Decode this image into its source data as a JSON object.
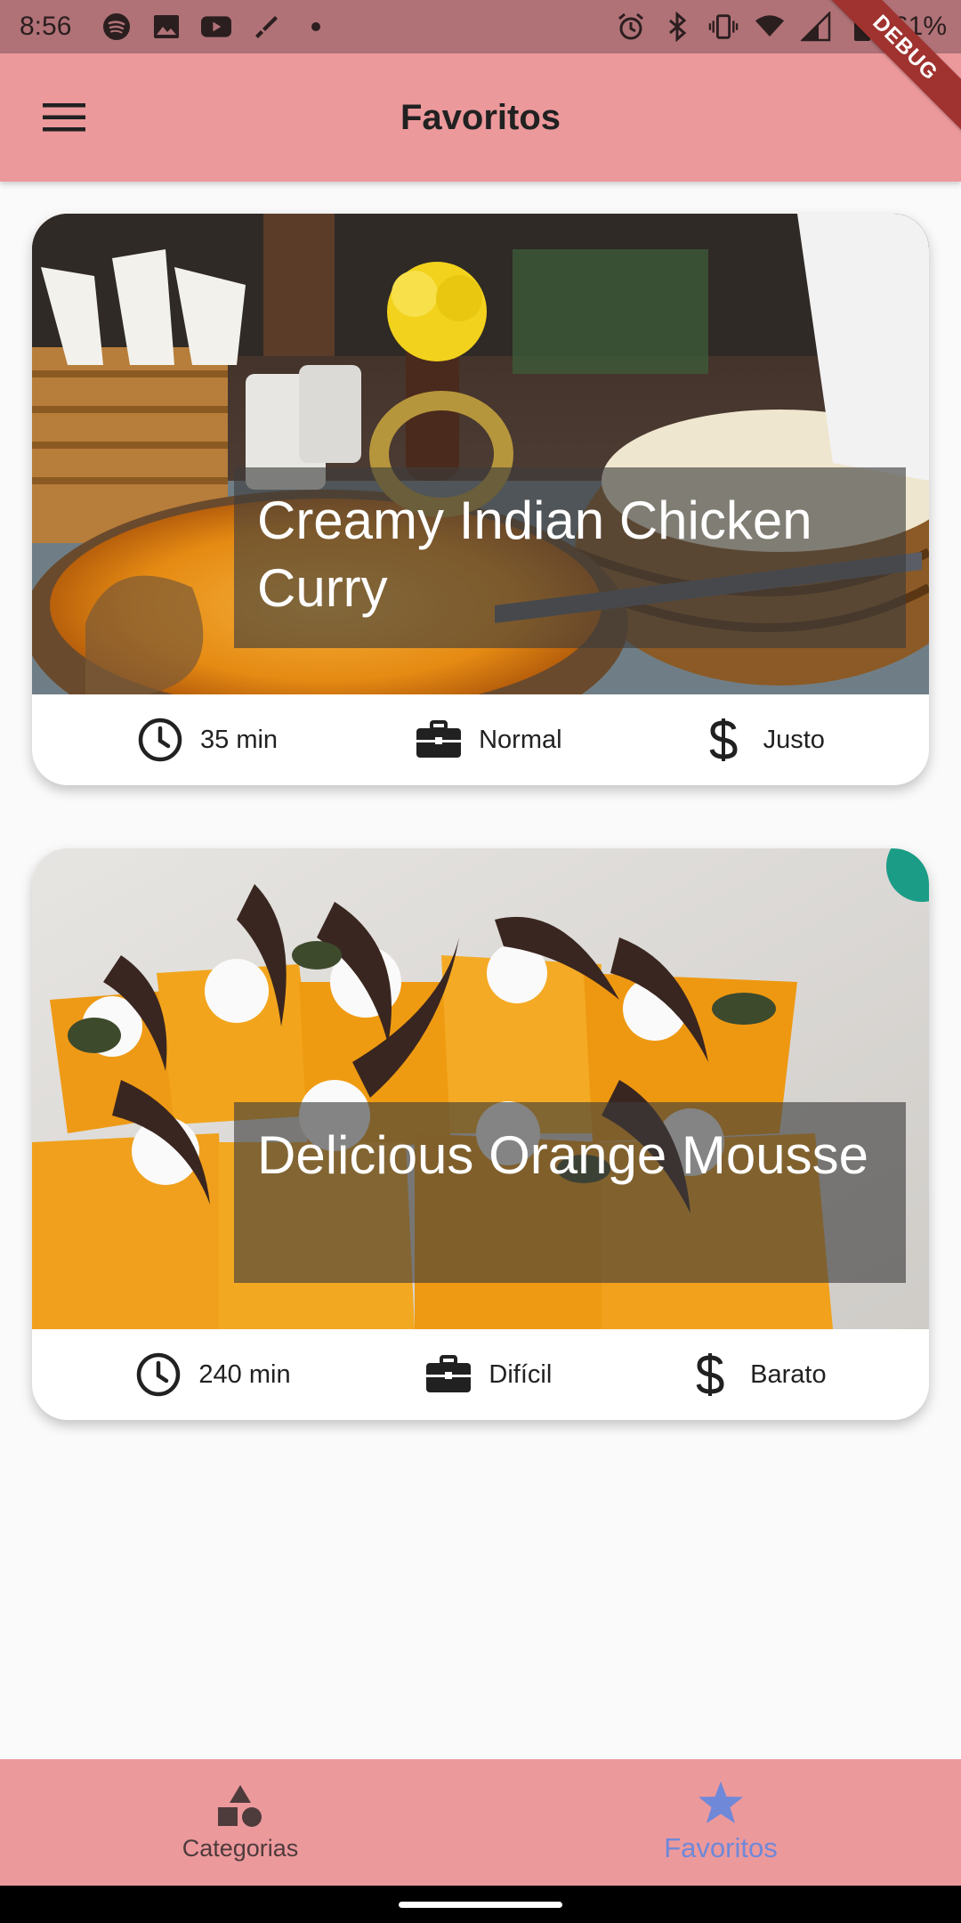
{
  "status_bar": {
    "time": "8:56",
    "battery": "61%",
    "left_icons": [
      "spotify-icon",
      "image-icon",
      "youtube-icon",
      "pen-icon",
      "dot-icon"
    ],
    "right_icons": [
      "alarm-icon",
      "bluetooth-icon",
      "vibrate-icon",
      "wifi-icon",
      "signal-icon",
      "battery-icon"
    ]
  },
  "debug_banner": "DEBUG",
  "app_bar": {
    "title": "Favoritos",
    "menu_icon": "menu-icon"
  },
  "meals": [
    {
      "title": "Creamy Indian Chicken Curry",
      "duration": "35 min",
      "complexity": "Normal",
      "cost": "Justo"
    },
    {
      "title": "Delicious Orange Mousse",
      "duration": "240 min",
      "complexity": "Difícil",
      "cost": "Barato"
    }
  ],
  "bottom_nav": {
    "items": [
      {
        "label": "Categorias",
        "icon": "category-icon",
        "active": false
      },
      {
        "label": "Favoritos",
        "icon": "star-icon",
        "active": true
      }
    ]
  },
  "colors": {
    "status_bar": "#b07277",
    "app_bar": "#ec999c",
    "nav_active": "#6f88d8",
    "background": "#fafafa"
  }
}
